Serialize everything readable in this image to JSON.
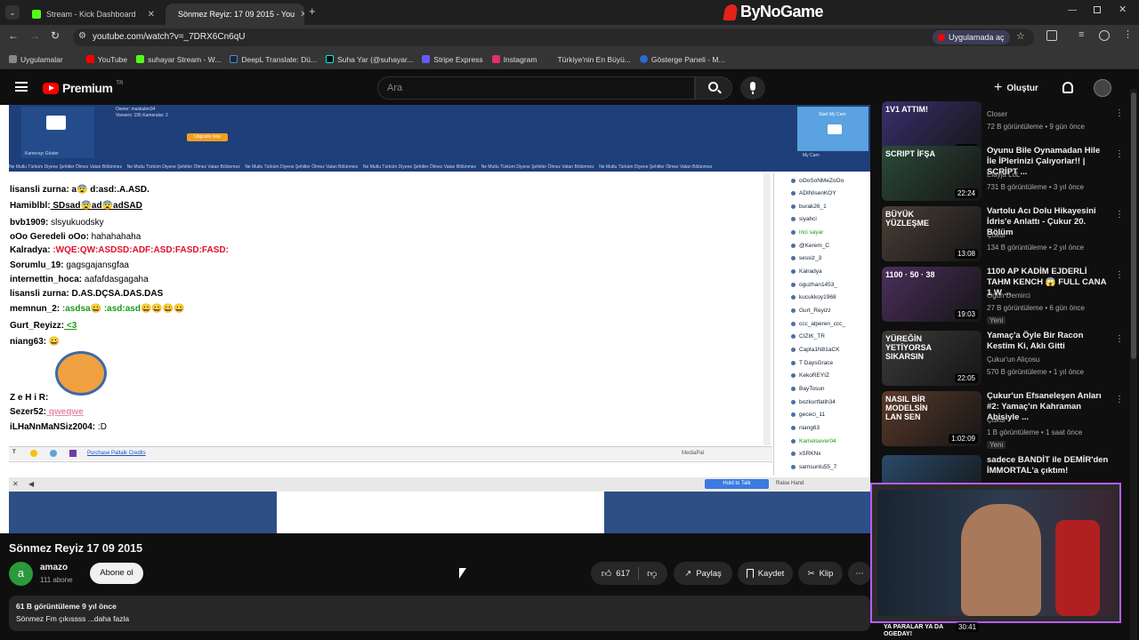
{
  "browser": {
    "tabs": [
      {
        "label": "Stream - Kick Dashboard",
        "close": "✕"
      },
      {
        "label": "Sönmez Reyiz: 17 09 2015 - You",
        "close": "✕"
      }
    ],
    "new_tab": "+",
    "brand": "ByNoGame",
    "url": "youtube.com/watch?v=_7DRX6Cn6qU",
    "open_in_app": "Uygulamada aç",
    "bookmarks": [
      {
        "label": "Uygulamalar",
        "color": "#888888"
      },
      {
        "label": "YouTube",
        "color": "#ff0000"
      },
      {
        "label": "suhayar Stream - W...",
        "color": "#53fc18"
      },
      {
        "label": "DeepL Translate: Dü...",
        "color": "#0f2b46"
      },
      {
        "label": "Suha Yar (@suhayar...",
        "color": "#000000"
      },
      {
        "label": "Stripe Express",
        "color": "#635bff"
      },
      {
        "label": "Instagram",
        "color": "#e1306c"
      },
      {
        "label": "Türkiye'nin En Büyü...",
        "color": "#333333"
      },
      {
        "label": "Gösterge Paneli - M...",
        "color": "#2a6ad1"
      }
    ]
  },
  "youtube": {
    "logo": "Premium",
    "logo_tr": "TR",
    "search_placeholder": "Ara",
    "create": "Oluştur",
    "video": {
      "status_text": "Ne Mutlu Türküm Diyene Şehitler Ölmez Vatan Bölünmez",
      "cam_show": "Kamerayı Göster",
      "start_cam": "Start My Cam",
      "my_cam": "My Cam",
      "owner": "Owner: maskulen34",
      "viewers": "Viewers: 195  Kameralar: 2",
      "upgrade": "Upgrade now",
      "purchase": "Purchase Paltalk Credits",
      "mediapal": "MediaPal",
      "hold_to_talk": "Hold to Talk",
      "raise_hand": "Raise Hand",
      "chat": [
        {
          "user": "lisansli zurna:",
          "msg": " a😨 d:asd:.A.ASD."
        },
        {
          "user": "Hamiblbl:",
          "msg": " SDsad😨ad😨adSAD"
        },
        {
          "user": "bvb1909:",
          "msg": " slsyukuodsky"
        },
        {
          "user": "oOo Geredeli oOo:",
          "msg": " hahahahaha"
        },
        {
          "user": "Kalradya:",
          "msg": " :WQE:QW:ASDSD:ADF:ASD:FASD:FASD:"
        },
        {
          "user": "Sorumlu_19:",
          "msg": " gagsgajansgfaa"
        },
        {
          "user": "internettin_hoca:",
          "msg": " aafafdasgagaha"
        },
        {
          "user": "lisansli zurna:",
          "msg": " D.AS.DÇSA.DAS.DAS"
        },
        {
          "user": "memnun_2:",
          "msg": " :asdsa😀 :asd:asd😀😀😀😀"
        },
        {
          "user": "Gurt_Reyizz:",
          "msg": " <3"
        },
        {
          "user": "niang63:",
          "msg": " 😀"
        },
        {
          "user": "Z e H i R:",
          "msg": ""
        },
        {
          "user": "Sezer52:",
          "msg": " qweqwe"
        },
        {
          "user": "iLHaNnMaNSiz2004:",
          "msg": " :D"
        }
      ],
      "users": [
        "oOoSoNMeZoOo",
        "ADINIsenKOY",
        "burak26_1",
        "siyahci",
        "inci sayar",
        "@Kerem_C",
        "sessiz_3",
        "Kalradya",
        "oguzhan1453_",
        "kucukkoy1968",
        "Gurt_Reyizz",
        "ccc_alperen_ccc_",
        "CIZIK_TR",
        "Capta1N81aCK",
        "T DaysGrace",
        "KekoREYIZ",
        "BayTosun",
        "bozkurtfatih34",
        "gececi_11",
        "niang63",
        "Kamelsever04",
        "xSRKNx",
        "samsunlu55_7"
      ]
    },
    "title": "Sönmez Reyiz 17 09 2015",
    "channel": {
      "name": "amazo",
      "avatar": "a",
      "subs": "111 abone",
      "subscribe": "Abone ol"
    },
    "actions": {
      "likes": "617",
      "share": "Paylaş",
      "save": "Kaydet",
      "clip": "Klip",
      "more": "⋯"
    },
    "description": {
      "stats": "61 B görüntüleme  9 yıl önce",
      "text": "Sönmez Fm çıkıssss  ...daha fazla"
    },
    "recommended": [
      {
        "title": "",
        "channel": "Closer",
        "meta": "72 B görüntüleme • 9 gün önce",
        "duration": "25:19",
        "thumb_text": "1V1 ATTIM!",
        "color": "#3a2f6e",
        "new": ""
      },
      {
        "title": "Oyunu Bile Oynamadan Hile İle İPlerinizi Çalıyorlar!! | SCRİPT ...",
        "channel": "Elayja LoL",
        "meta": "731 B görüntüleme • 3 yıl önce",
        "duration": "22:24",
        "thumb_text": "SCRIPT İFŞA",
        "color": "#2c4a3a",
        "new": ""
      },
      {
        "title": "Vartolu Acı Dolu Hikayesini İdris'e Anlattı - Çukur 20. Bölüm",
        "channel": "Çukur",
        "meta": "134 B görüntüleme • 2 yıl önce",
        "duration": "13:08",
        "thumb_text": "BÜYÜK YÜZLEŞME",
        "color": "#4a3f36",
        "new": ""
      },
      {
        "title": "1100 AP KADİM EJDERLİ TAHM KENCH 😱 FULL CANA 1 W ...",
        "channel": "Ogün Demirci",
        "meta": "27 B görüntüleme • 6 gün önce",
        "duration": "19:03",
        "thumb_text": "1100 · 50 · 38",
        "color": "#4c2f5c",
        "new": "Yeni"
      },
      {
        "title": "Yamaç'a Öyle Bir Racon Kestim Ki, Aklı Gitti",
        "channel": "Çukur'un Aliçosu",
        "meta": "570 B görüntüleme • 1 yıl önce",
        "duration": "22:05",
        "thumb_text": "YÜREĞİN YETİYORSA SIKARSIN",
        "color": "#3d3b3a",
        "new": ""
      },
      {
        "title": "Çukur'un Efsaneleşen Anları #2: Yamaç'ın Kahraman Abisiyle ...",
        "channel": "Çukur",
        "meta": "1 B görüntüleme • 1 saat önce",
        "duration": "1:02:09",
        "thumb_text": "NASIL BİR MODELSİN LAN SEN",
        "color": "#5a3a2a",
        "new": "Yeni"
      },
      {
        "title": "sadece BANDİT ile DEMİR'den İMMORTAL'a çıktım!",
        "channel": "",
        "meta": "",
        "duration": "30:41",
        "thumb_text": "",
        "color": "#2a4a6a",
        "new": ""
      }
    ],
    "last_thumb_caption": "YA PARALAR YA DA OGEDAY!"
  }
}
